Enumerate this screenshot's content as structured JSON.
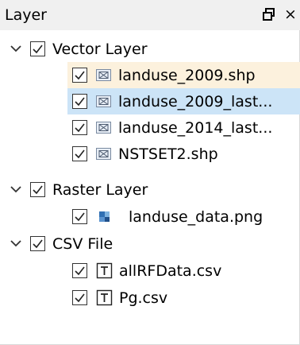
{
  "panel": {
    "title": "Layer",
    "float_glyph": "float-icon",
    "close_glyph": "×"
  },
  "groups": [
    {
      "name": "Vector Layer",
      "checked": true,
      "expanded": true,
      "items": [
        {
          "name": "landuse_2009.shp",
          "checked": true,
          "icon": "vector-layer-icon",
          "state": "hover"
        },
        {
          "name": "landuse_2009_last...",
          "checked": true,
          "icon": "vector-layer-icon",
          "state": "selected"
        },
        {
          "name": "landuse_2014_last...",
          "checked": true,
          "icon": "vector-layer-icon",
          "state": "normal"
        },
        {
          "name": "NSTSET2.shp",
          "checked": true,
          "icon": "vector-layer-icon",
          "state": "normal"
        }
      ]
    },
    {
      "name": "Raster Layer",
      "checked": true,
      "expanded": true,
      "items": [
        {
          "name": "landuse_data.png",
          "checked": true,
          "icon": "raster-layer-icon",
          "state": "normal"
        }
      ]
    },
    {
      "name": "CSV File",
      "checked": true,
      "expanded": true,
      "items": [
        {
          "name": "allRFData.csv",
          "checked": true,
          "icon": "text-file-icon",
          "state": "normal"
        },
        {
          "name": "Pg.csv",
          "checked": true,
          "icon": "text-file-icon",
          "state": "normal"
        }
      ]
    }
  ],
  "colors": {
    "hover_row": "#fcf1dd",
    "selected_row": "#cce4f7",
    "title_bg": "#f0f0f0"
  }
}
